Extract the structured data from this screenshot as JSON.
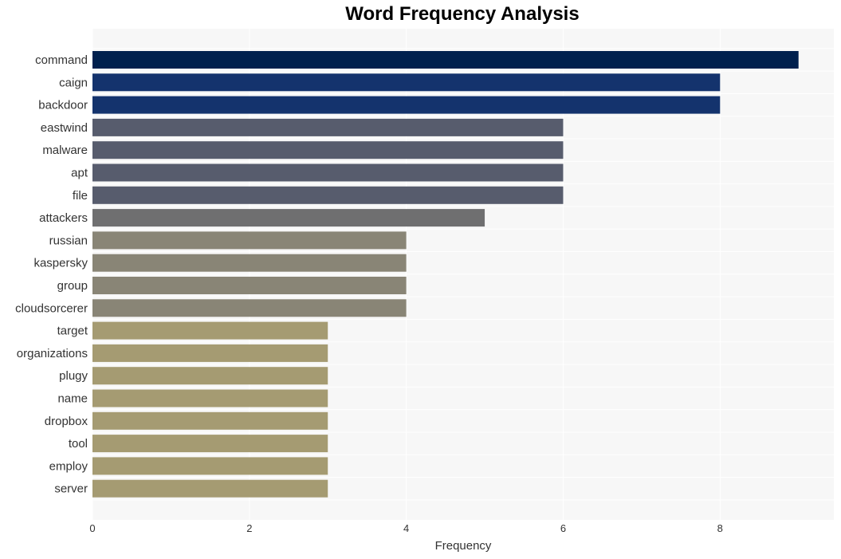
{
  "chart_data": {
    "type": "bar",
    "orientation": "horizontal",
    "title": "Word Frequency Analysis",
    "xlabel": "Frequency",
    "ylabel": "",
    "xlim": [
      0,
      9.45
    ],
    "xticks": [
      0,
      2,
      4,
      6,
      8
    ],
    "grid": true,
    "legend": "none",
    "categories": [
      "command",
      "caign",
      "backdoor",
      "eastwind",
      "malware",
      "apt",
      "file",
      "attackers",
      "russian",
      "kaspersky",
      "group",
      "cloudsorcerer",
      "target",
      "organizations",
      "plugy",
      "name",
      "dropbox",
      "tool",
      "employ",
      "server"
    ],
    "values": [
      9,
      8,
      8,
      6,
      6,
      6,
      6,
      5,
      4,
      4,
      4,
      4,
      3,
      3,
      3,
      3,
      3,
      3,
      3,
      3
    ],
    "colors": [
      "#00204e",
      "#14336d",
      "#14336d",
      "#575c6d",
      "#575c6d",
      "#575c6d",
      "#575c6d",
      "#6f6f70",
      "#898576",
      "#898576",
      "#898576",
      "#898576",
      "#a59b72",
      "#a59b72",
      "#a59b72",
      "#a59b72",
      "#a59b72",
      "#a59b72",
      "#a59b72",
      "#a59b72"
    ]
  }
}
